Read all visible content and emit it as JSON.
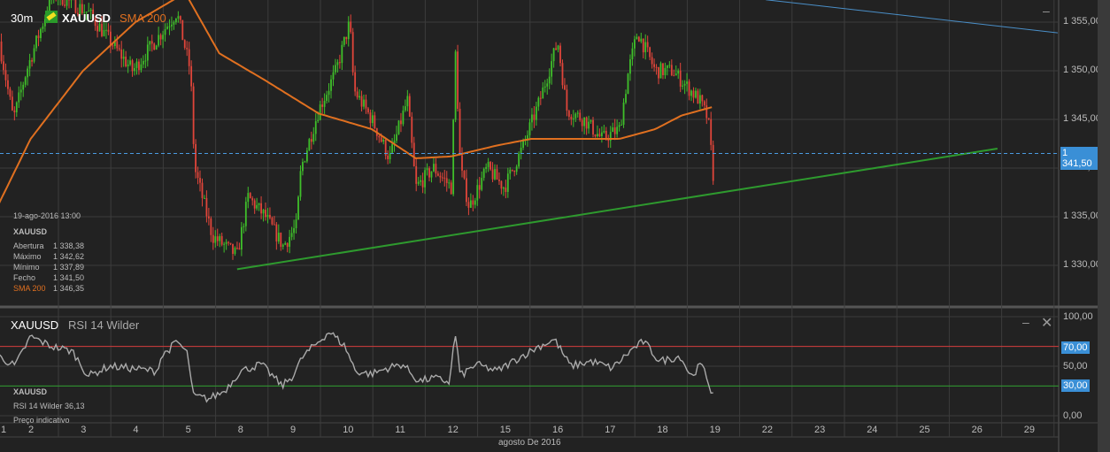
{
  "header": {
    "timeframe": "30m",
    "symbol": "XAUUSD",
    "indicator": "SMA 200"
  },
  "info_panel": {
    "datetime": "19-ago-2016 13:00",
    "symbol": "XAUUSD",
    "rows": [
      {
        "label": "Abertura",
        "value": "1 338,38"
      },
      {
        "label": "Máximo",
        "value": "1 342,62"
      },
      {
        "label": "Mínimo",
        "value": "1 337,89"
      },
      {
        "label": "Fecho",
        "value": "1 341,50"
      }
    ],
    "sma_label": "SMA 200",
    "sma_value": "1 346,35"
  },
  "rsi_panel": {
    "symbol": "XAUUSD",
    "indicator": "RSI 14 Wilder",
    "info_symbol": "XAUUSD",
    "info_value": "RSI 14 Wilder  36,13",
    "info_note": "Preço indicativo",
    "axis": [
      "100,00",
      "50,00",
      "0,00"
    ],
    "tag_70": "70,00",
    "tag_30": "30,00"
  },
  "price_axis": [
    "1 355,00",
    "1 350,00",
    "1 345,00",
    "1 340,00",
    "1 335,00",
    "1 330,00"
  ],
  "last_price_tag": "1 341,50",
  "x_axis": {
    "days": [
      "1",
      "2",
      "3",
      "4",
      "5",
      "8",
      "9",
      "10",
      "11",
      "12",
      "15",
      "16",
      "17",
      "18",
      "19",
      "22",
      "23",
      "24",
      "25",
      "26",
      "29"
    ],
    "month_label": "agosto De 2016"
  },
  "colors": {
    "up": "#3fbf2a",
    "down": "#e0453a",
    "sma": "#e07020",
    "support": "#2e9a2e",
    "resistance": "#4a8fc8",
    "tag": "#3a8fd6"
  },
  "chart_data": {
    "type": "candlestick",
    "x_unit": "trading days from Aug 1",
    "price_range": [
      1327,
      1357.3
    ],
    "last_close": 1341.5,
    "price_path": [
      [
        -0.1,
        1353
      ],
      [
        0.17,
        1345
      ],
      [
        0.42,
        1350
      ],
      [
        0.93,
        1358
      ],
      [
        1.6,
        1356
      ],
      [
        2.45,
        1350
      ],
      [
        3.29,
        1356
      ],
      [
        3.55,
        1350
      ],
      [
        3.63,
        1340
      ],
      [
        3.97,
        1333
      ],
      [
        4.44,
        1331
      ],
      [
        4.65,
        1337
      ],
      [
        4.98,
        1335
      ],
      [
        5.32,
        1332
      ],
      [
        5.57,
        1334
      ],
      [
        5.66,
        1340
      ],
      [
        6.0,
        1346
      ],
      [
        6.33,
        1350
      ],
      [
        6.59,
        1355
      ],
      [
        6.67,
        1348
      ],
      [
        7.01,
        1345
      ],
      [
        7.35,
        1341
      ],
      [
        7.69,
        1347
      ],
      [
        7.85,
        1338
      ],
      [
        8.19,
        1340
      ],
      [
        8.53,
        1338
      ],
      [
        8.61,
        1352
      ],
      [
        8.7,
        1340
      ],
      [
        8.87,
        1336
      ],
      [
        9.21,
        1340
      ],
      [
        9.54,
        1338
      ],
      [
        9.88,
        1342
      ],
      [
        10.22,
        1347
      ],
      [
        10.56,
        1353
      ],
      [
        10.73,
        1346
      ],
      [
        11.06,
        1345
      ],
      [
        11.4,
        1343
      ],
      [
        11.74,
        1344
      ],
      [
        11.91,
        1350
      ],
      [
        12.08,
        1354
      ],
      [
        12.42,
        1350
      ],
      [
        12.75,
        1350
      ],
      [
        12.92,
        1349
      ],
      [
        13.26,
        1347
      ],
      [
        13.43,
        1345
      ],
      [
        13.53,
        1339
      ],
      [
        13.56,
        1341.5
      ]
    ],
    "sma_path": [
      [
        -0.1,
        1336.4
      ],
      [
        0.5,
        1343
      ],
      [
        1.5,
        1350
      ],
      [
        2.5,
        1355
      ],
      [
        3.45,
        1358
      ],
      [
        4.1,
        1351.8
      ],
      [
        4.98,
        1349
      ],
      [
        6.0,
        1345.6
      ],
      [
        7.01,
        1344
      ],
      [
        7.85,
        1341
      ],
      [
        8.53,
        1341.2
      ],
      [
        9.38,
        1342.3
      ],
      [
        10.05,
        1343
      ],
      [
        11.06,
        1343
      ],
      [
        11.74,
        1343
      ],
      [
        12.42,
        1344
      ],
      [
        12.92,
        1345.4
      ],
      [
        13.53,
        1346.3
      ]
    ],
    "support_line": [
      [
        4.44,
        1329.6
      ],
      [
        18.95,
        1342
      ]
    ],
    "resistance_line": [
      [
        14.53,
        1357.3
      ],
      [
        20.1,
        1353.9
      ]
    ],
    "rsi_path": [
      [
        -0.1,
        60
      ],
      [
        0.2,
        50
      ],
      [
        0.5,
        80
      ],
      [
        0.9,
        70
      ],
      [
        1.3,
        65
      ],
      [
        1.6,
        40
      ],
      [
        2.0,
        50
      ],
      [
        2.4,
        48
      ],
      [
        2.9,
        45
      ],
      [
        3.0,
        60
      ],
      [
        3.3,
        75
      ],
      [
        3.5,
        62
      ],
      [
        3.6,
        20
      ],
      [
        3.9,
        17
      ],
      [
        4.2,
        25
      ],
      [
        4.5,
        45
      ],
      [
        4.9,
        52
      ],
      [
        5.3,
        30
      ],
      [
        5.5,
        40
      ],
      [
        5.7,
        60
      ],
      [
        6.0,
        75
      ],
      [
        6.2,
        85
      ],
      [
        6.5,
        70
      ],
      [
        6.7,
        45
      ],
      [
        7.0,
        42
      ],
      [
        7.3,
        48
      ],
      [
        7.6,
        52
      ],
      [
        7.9,
        35
      ],
      [
        8.2,
        38
      ],
      [
        8.5,
        34
      ],
      [
        8.6,
        85
      ],
      [
        8.7,
        40
      ],
      [
        9.0,
        52
      ],
      [
        9.4,
        45
      ],
      [
        9.8,
        58
      ],
      [
        10.2,
        70
      ],
      [
        10.5,
        77
      ],
      [
        10.8,
        50
      ],
      [
        11.2,
        55
      ],
      [
        11.6,
        48
      ],
      [
        12.0,
        68
      ],
      [
        12.2,
        75
      ],
      [
        12.5,
        55
      ],
      [
        12.9,
        60
      ],
      [
        13.1,
        40
      ],
      [
        13.3,
        52
      ],
      [
        13.45,
        32
      ],
      [
        13.5,
        20
      ],
      [
        13.56,
        36.13
      ]
    ],
    "rsi_levels": [
      70,
      30
    ],
    "rsi_range": [
      0,
      100
    ]
  }
}
